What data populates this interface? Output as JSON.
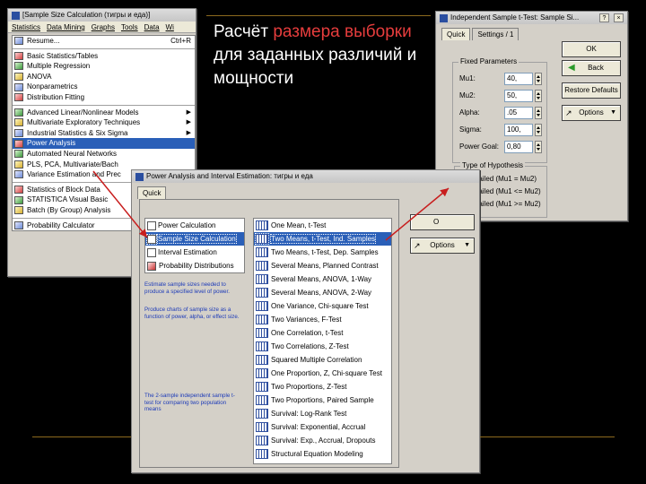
{
  "slide": {
    "title_parts": [
      "Расчёт ",
      "размера выборки",
      " для заданных различий и мощности"
    ]
  },
  "menu_window": {
    "title": "[Sample Size Calculation (тигры и еда)]",
    "menubar": [
      "Statistics",
      "Data Mining",
      "Graphs",
      "Tools",
      "Data",
      "Wi"
    ],
    "items": [
      {
        "label": "Resume...",
        "shortcut": "Ctrl+R",
        "icon": "resume-icon"
      },
      {
        "label": "Basic Statistics/Tables",
        "icon": "basic-stats-icon"
      },
      {
        "label": "Multiple Regression",
        "icon": "regression-icon"
      },
      {
        "label": "ANOVA",
        "icon": "anova-icon"
      },
      {
        "label": "Nonparametrics",
        "icon": "nonparametrics-icon"
      },
      {
        "label": "Distribution Fitting",
        "icon": "distribution-icon"
      },
      {
        "label": "Advanced Linear/Nonlinear Models",
        "icon": "advanced-models-icon",
        "submenu": true
      },
      {
        "label": "Multivariate Exploratory Techniques",
        "icon": "multivariate-icon",
        "submenu": true
      },
      {
        "label": "Industrial Statistics & Six Sigma",
        "icon": "six-sigma-icon",
        "submenu": true
      },
      {
        "label": "Power Analysis",
        "icon": "power-analysis-icon",
        "highlighted": true
      },
      {
        "label": "Automated Neural Networks",
        "icon": "neural-networks-icon"
      },
      {
        "label": "PLS, PCA, Multivariate/Bach",
        "icon": "pls-icon"
      },
      {
        "label": "Variance Estimation and Prec",
        "icon": "variance-icon"
      },
      {
        "label": "Statistics of Block Data",
        "icon": "block-data-icon"
      },
      {
        "label": "STATISTICA Visual Basic",
        "icon": "visual-basic-icon"
      },
      {
        "label": "Batch (By Group) Analysis",
        "icon": "batch-icon"
      },
      {
        "label": "Probability Calculator",
        "icon": "probability-icon"
      }
    ]
  },
  "ttest_window": {
    "title": "Independent Sample t-Test: Sample Si...",
    "tabs": [
      "Quick",
      "Settings / 1"
    ],
    "fixed_params_title": "Fixed Parameters",
    "params": [
      {
        "label": "Mu1:",
        "value": "40,"
      },
      {
        "label": "Mu2:",
        "value": "50,"
      },
      {
        "label": "Alpha:",
        "value": ".05"
      },
      {
        "label": "Sigma:",
        "value": "100,"
      },
      {
        "label": "Power Goal:",
        "value": "0,80"
      }
    ],
    "hypothesis_title": "Type of Hypothesis",
    "hypotheses": [
      {
        "label": "2-tailed (Mu1 = Mu2)",
        "selected": true
      },
      {
        "label": "1-tailed (Mu1 <= Mu2)",
        "selected": false
      },
      {
        "label": "1-tailed (Mu1 >= Mu2)",
        "selected": false
      }
    ],
    "ok_label": "OK",
    "back_label": "Back",
    "restore_label": "Restore Defaults",
    "options_label": "Options"
  },
  "power_window": {
    "title": "Power Analysis and Interval Estimation: тигры и еда",
    "tab": "Quick",
    "left_items": [
      {
        "label": "Power Calculation",
        "selected": false,
        "icon": "checkbox"
      },
      {
        "label": "Sample Size Calculation",
        "selected": true,
        "icon": "checkbox"
      },
      {
        "label": "Interval Estimation",
        "selected": false,
        "icon": "checkbox"
      },
      {
        "label": "Probability Distributions",
        "selected": false,
        "icon": "dist"
      }
    ],
    "desc1": "Estimate sample sizes needed to produce a specified level of power.",
    "desc2": "Produce charts of sample size as a function of power, alpha, or effect size.",
    "desc3": "The 2-sample independent sample t-test for comparing two population means",
    "right_items": [
      {
        "label": "One Mean, t-Test",
        "selected": false
      },
      {
        "label": "Two Means, t-Test, Ind. Samples",
        "selected": true
      },
      {
        "label": "Two Means, t-Test, Dep. Samples",
        "selected": false
      },
      {
        "label": "Several Means, Planned Contrast",
        "selected": false
      },
      {
        "label": "Several Means, ANOVA, 1-Way",
        "selected": false
      },
      {
        "label": "Several Means, ANOVA, 2-Way",
        "selected": false
      },
      {
        "label": "One Variance, Chi-square Test",
        "selected": false
      },
      {
        "label": "Two Variances, F-Test",
        "selected": false
      },
      {
        "label": "One Correlation, t-Test",
        "selected": false
      },
      {
        "label": "Two Correlations, Z-Test",
        "selected": false
      },
      {
        "label": "Squared Multiple Correlation",
        "selected": false
      },
      {
        "label": "One Proportion, Z, Chi-square Test",
        "selected": false
      },
      {
        "label": "Two Proportions, Z-Test",
        "selected": false
      },
      {
        "label": "Two Proportions, Paired Sample",
        "selected": false
      },
      {
        "label": "Survival: Log-Rank Test",
        "selected": false
      },
      {
        "label": "Survival: Exponential, Accrual",
        "selected": false
      },
      {
        "label": "Survival: Exp., Accrual, Dropouts",
        "selected": false
      },
      {
        "label": "Structural Equation Modeling",
        "selected": false
      }
    ],
    "ok_label": "O",
    "options_label": "Options"
  },
  "colors": {
    "background": "#000000",
    "title_text": "#ffffff",
    "title_highlight": "#e63d3d",
    "selection": "#2a5fb8",
    "arrow": "#c81e1e",
    "rule": "#8c6a1e"
  }
}
